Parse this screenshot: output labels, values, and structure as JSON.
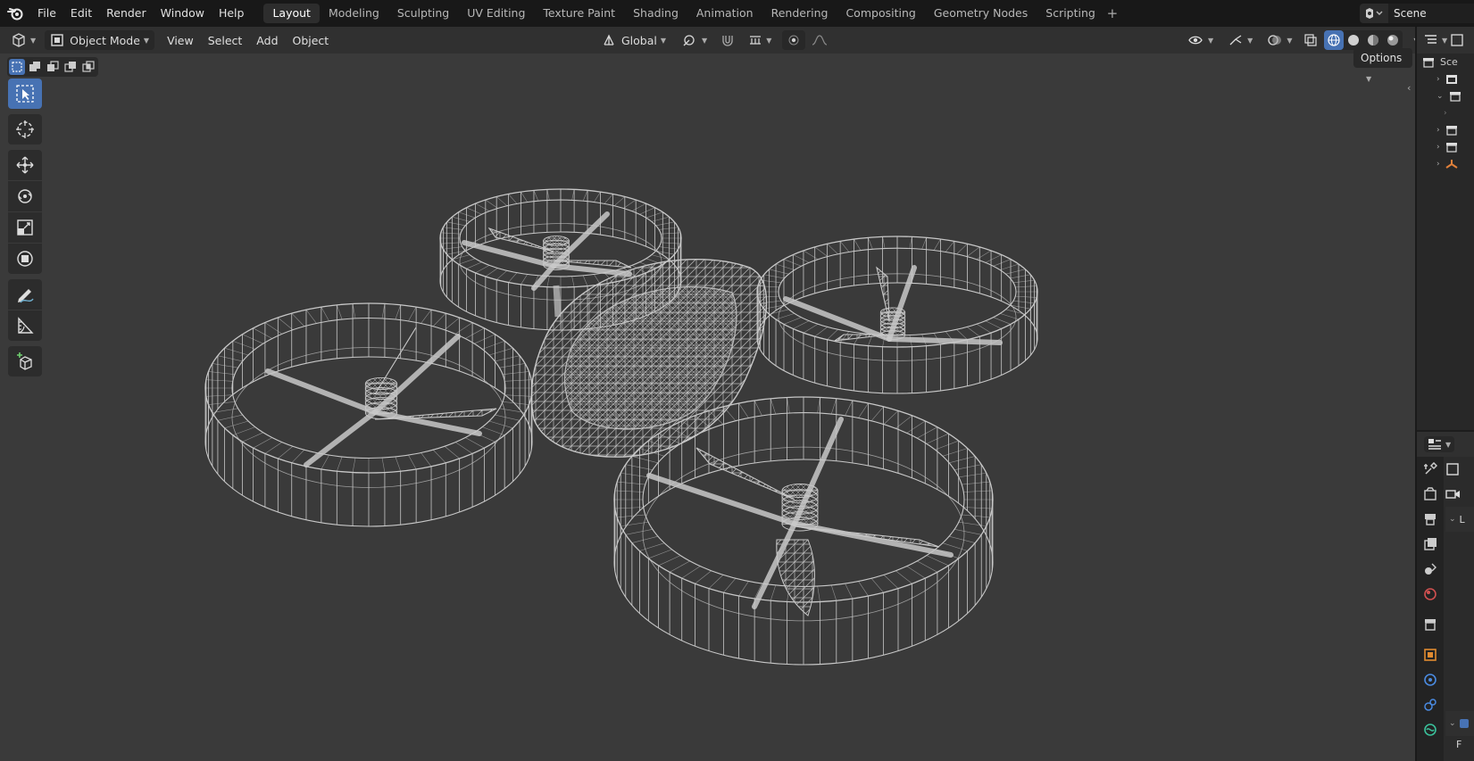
{
  "top_menu": [
    "File",
    "Edit",
    "Render",
    "Window",
    "Help"
  ],
  "workspace_tabs": [
    {
      "label": "Layout",
      "active": true
    },
    {
      "label": "Modeling"
    },
    {
      "label": "Sculpting"
    },
    {
      "label": "UV Editing"
    },
    {
      "label": "Texture Paint"
    },
    {
      "label": "Shading"
    },
    {
      "label": "Animation"
    },
    {
      "label": "Rendering"
    },
    {
      "label": "Compositing"
    },
    {
      "label": "Geometry Nodes"
    },
    {
      "label": "Scripting"
    }
  ],
  "workspace_add": "+",
  "scene": {
    "name": "Scene"
  },
  "viewport": {
    "mode": "Object Mode",
    "menus": [
      "View",
      "Select",
      "Add",
      "Object"
    ],
    "transform_orientation": "Global",
    "options_label": "Options",
    "background_color": "#3a3a3a",
    "wire_color": "#c8c8c8"
  },
  "toolbar_tools": [
    "select-box-icon",
    "cursor-icon",
    "move-icon",
    "rotate-icon",
    "scale-icon",
    "transform-icon",
    "annotate-icon",
    "measure-icon",
    "add-cube-icon"
  ],
  "outliner": {
    "header_label": "Sce",
    "rows": [
      "",
      "",
      "",
      "",
      "",
      ""
    ]
  },
  "properties": {
    "tabs": [
      "tool-icon",
      "render-icon",
      "output-icon",
      "view-layer-icon",
      "scene-icon",
      "world-icon",
      "collection-icon",
      "object-icon",
      "modifier-icon",
      "particles-icon",
      "physics-icon"
    ],
    "panel_label": "L",
    "panel_label2": "F"
  },
  "accent_color": "#4772b3"
}
